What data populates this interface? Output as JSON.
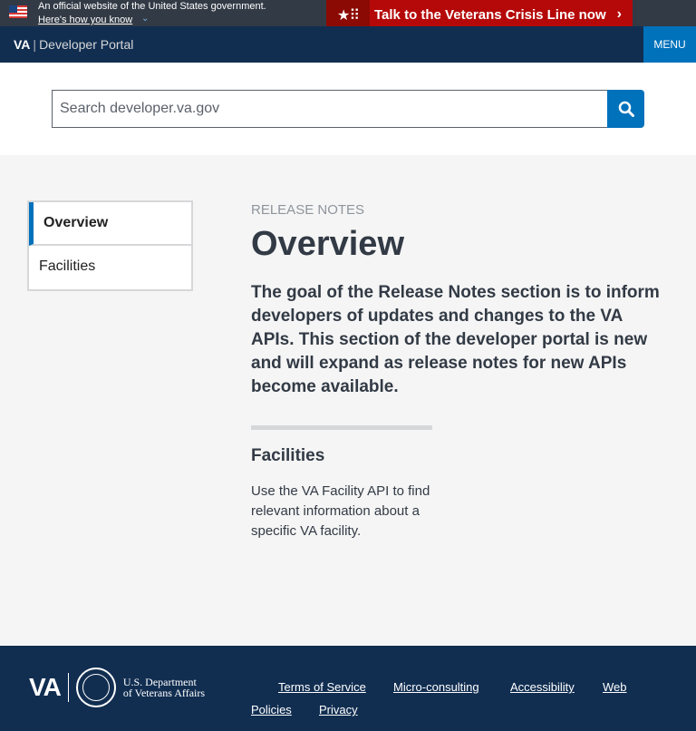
{
  "gov_banner": {
    "official_text": "An official website of the United States government.",
    "how_you_know": "Here's how you know"
  },
  "crisis_line": {
    "label": "Talk to the Veterans Crisis Line now"
  },
  "header": {
    "logo_va": "VA",
    "logo_sep": "|",
    "logo_portal": "Developer Portal",
    "menu_label": "MENU"
  },
  "search": {
    "placeholder": "Search developer.va.gov"
  },
  "sidenav": {
    "items": [
      {
        "label": "Overview",
        "active": true
      },
      {
        "label": "Facilities",
        "active": false
      }
    ]
  },
  "main": {
    "eyebrow": "RELEASE NOTES",
    "title": "Overview",
    "lead": "The goal of the Release Notes section is to inform developers of updates and changes to the VA APIs. This section of the developer portal is new and will expand as release notes for new APIs become available.",
    "card": {
      "title": "Facilities",
      "description": "Use the VA Facility API to find relevant information about a specific VA facility."
    }
  },
  "footer": {
    "logo_va": "VA",
    "dept_line1": "U.S. Department",
    "dept_line2": "of Veterans Affairs",
    "links": [
      "Terms of Service",
      "Micro-consulting",
      "Accessibility",
      "Web",
      "Policies",
      "Privacy"
    ]
  },
  "colors": {
    "banner_bg": "#323a45",
    "header_bg": "#112e51",
    "accent": "#0071bb",
    "crisis_red": "#b50909"
  }
}
